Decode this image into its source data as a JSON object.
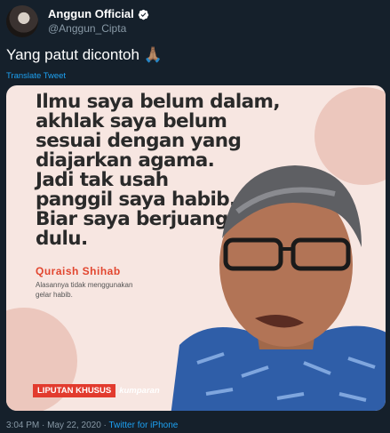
{
  "tweet": {
    "display_name": "Anggun Official",
    "handle": "@Anggun_Cipta",
    "text": "Yang patut dicontoh 🙏🏽",
    "translate_label": "Translate Tweet",
    "time": "3:04 PM",
    "separator": "·",
    "date": "May 22, 2020",
    "source": "Twitter for iPhone"
  },
  "image": {
    "quote_lines": [
      "Ilmu saya belum dalam,",
      "akhlak saya belum",
      "sesuai dengan yang",
      "diajarkan agama.",
      "Jadi tak usah",
      "panggil saya habib.",
      "Biar saya berjuang",
      "dulu."
    ],
    "speaker": "Quraish Shihab",
    "caption_lines": [
      "Alasannya tidak menggunakan",
      "gelar habib."
    ],
    "badge_label": "LIPUTAN KHUSUS",
    "brand": "kumparan"
  },
  "colors": {
    "background": "#15202b",
    "link": "#1da1f2",
    "muted": "#8899a6",
    "accent_red": "#e23b2e"
  },
  "icons": {
    "verified": "verified-badge-icon"
  }
}
